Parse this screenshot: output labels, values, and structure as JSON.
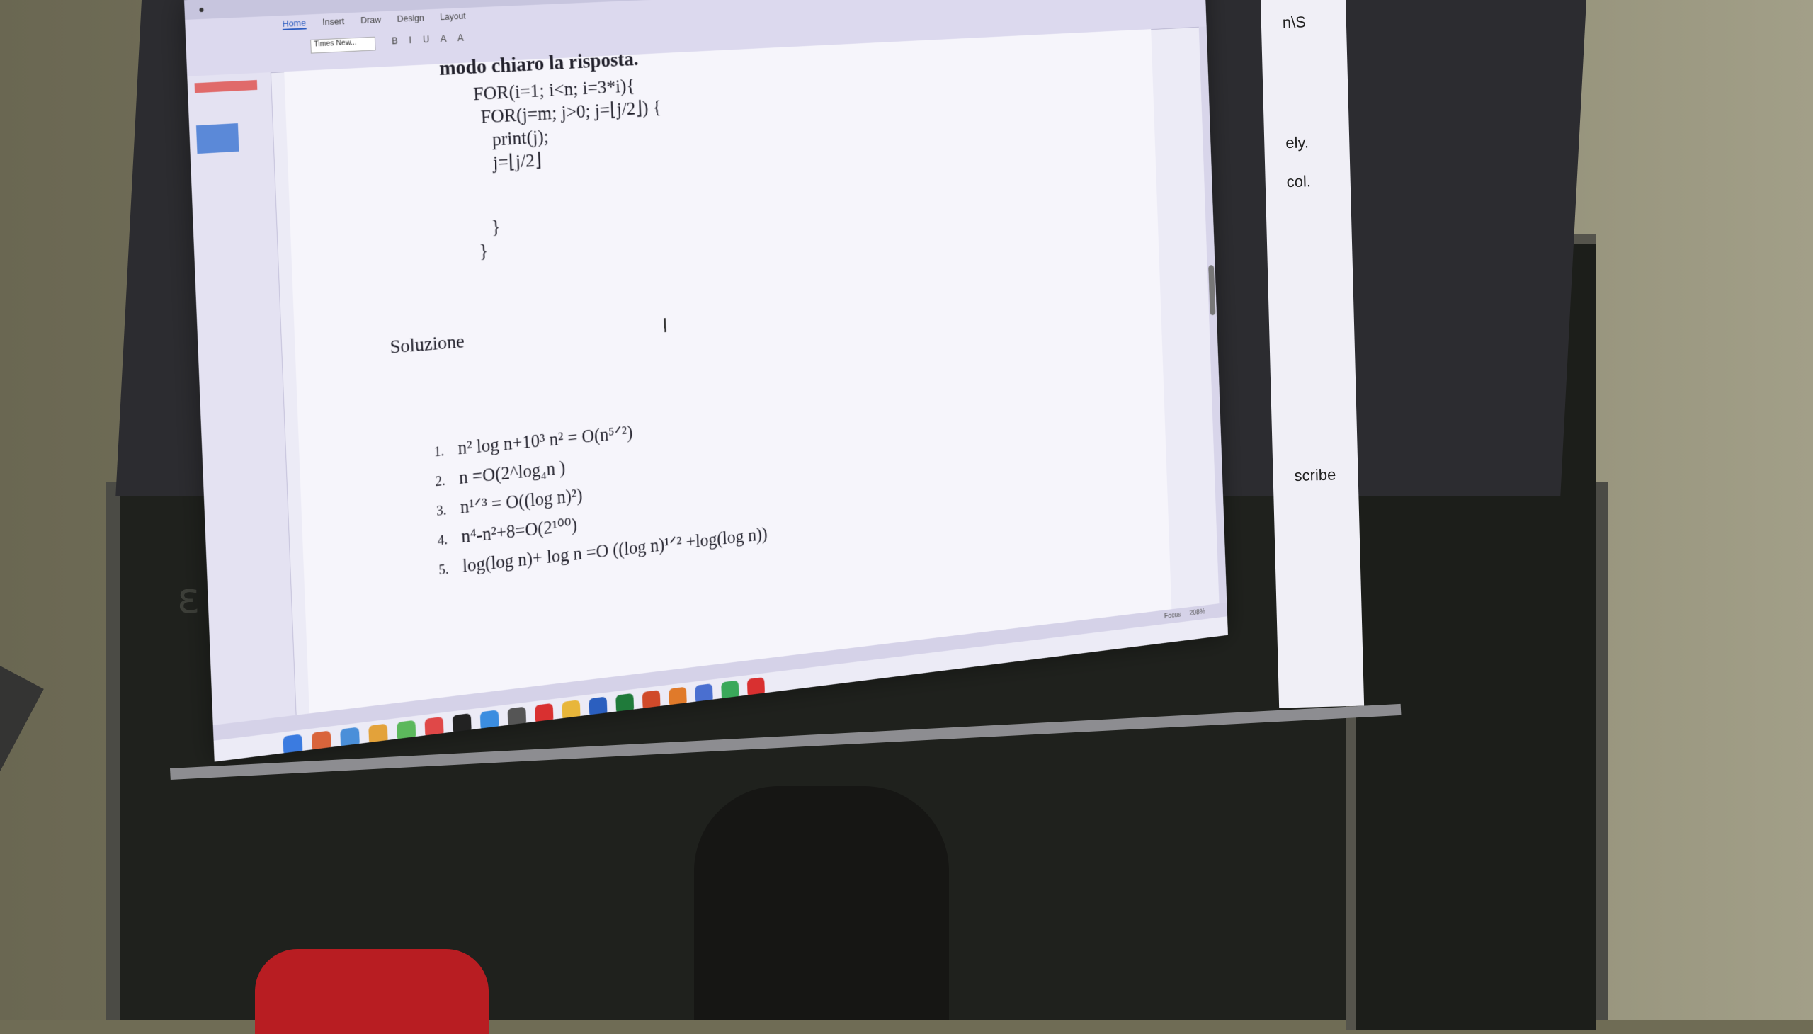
{
  "document": {
    "heading": "modo chiaro la risposta.",
    "code_lines": [
      "FOR(i=1; i<n; i=3*i){",
      "FOR(j=m; j>0; j=⌊j/2⌋) {",
      "print(j);",
      "j=⌊j/2⌋",
      "}",
      "}"
    ],
    "solution_title": "Soluzione",
    "solution_items": [
      {
        "num": "1.",
        "text": "n² log n+10³ n² = O(n⁵ᐟ²)"
      },
      {
        "num": "2.",
        "text": "n =O(2^log₄n )"
      },
      {
        "num": "3.",
        "text": "n¹ᐟ³ = O((log n)²)"
      },
      {
        "num": "4.",
        "text": "n⁴-n²+8=O(2¹⁰⁰)"
      },
      {
        "num": "5.",
        "text": "log(log n)+ log n =O ((log n)¹ᐟ² +log(log n))"
      }
    ]
  },
  "ribbon": {
    "tabs": [
      "Home",
      "Insert",
      "Draw",
      "Design",
      "Layout"
    ],
    "font_name": "Times New..."
  },
  "background_window": {
    "fragments": [
      "n\\S",
      "ely.",
      "col.",
      "scribe"
    ]
  },
  "status": {
    "zoom": "208%",
    "focus": "Focus"
  },
  "colors": {
    "screen": "#ecebf6",
    "text": "#22212c",
    "chalkboard": "#1f211d",
    "red_object": "#b81d22"
  },
  "icons": {
    "cursor": "text-cursor-ibeam-icon"
  }
}
